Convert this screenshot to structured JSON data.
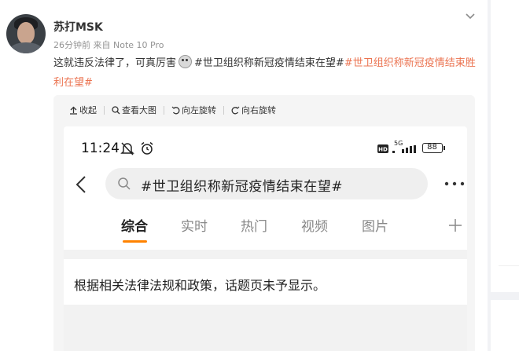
{
  "post": {
    "username": "苏打MSK",
    "meta": "26分钟前  来自 Note 10 Pro",
    "text_plain": "这就违反法律了，可真厉害",
    "tag_black": "#世卫组织称新冠疫情结束在望#",
    "tag_orange": "#世卫组织称新冠疫情结束胜利在望#"
  },
  "toolbar": {
    "collapse_label": "收起",
    "view_large_label": "查看大图",
    "rotate_left_label": "向左旋转",
    "rotate_right_label": "向右旋转"
  },
  "screenshot": {
    "time": "11:24",
    "network": "5G",
    "battery": "88",
    "search_query": "#世卫组织称新冠疫情结束在望#",
    "tabs": [
      "综合",
      "实时",
      "热门",
      "视频",
      "图片"
    ],
    "notice": "根据相关法律法规和政策，话题页未予显示。"
  },
  "colors": {
    "accent": "#ff8200",
    "link": "#eb7350"
  },
  "icons": [
    "chevron-down-icon",
    "collapse-icon",
    "search-icon",
    "rotate-left-icon",
    "rotate-right-icon",
    "back-arrow-icon",
    "more-icon",
    "plus-icon",
    "mute-icon",
    "alarm-icon",
    "hd-icon",
    "signal-icon",
    "battery-icon"
  ]
}
